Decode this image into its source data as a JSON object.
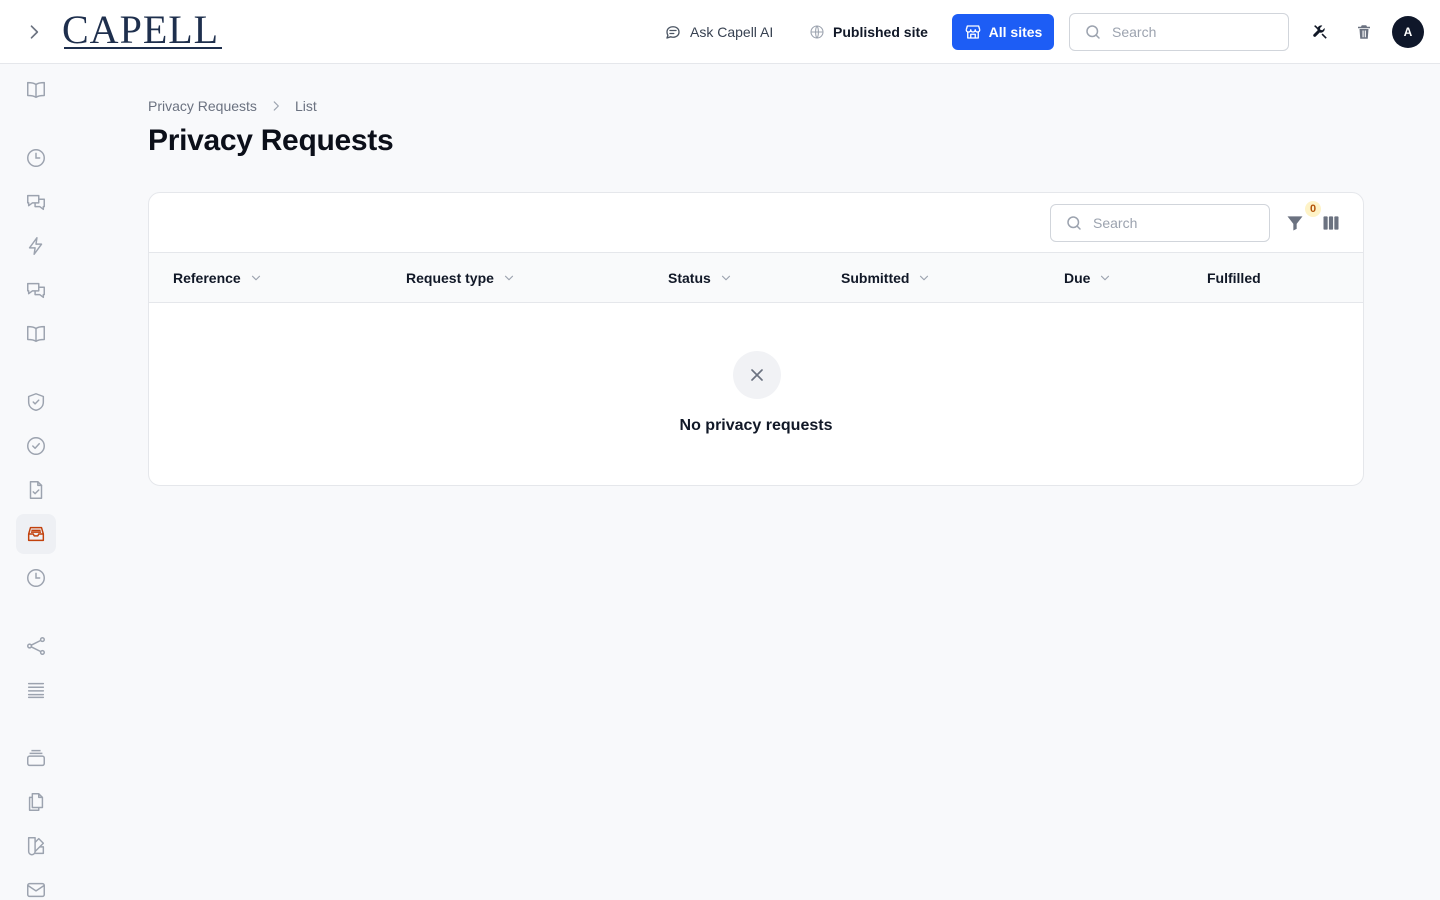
{
  "header": {
    "logo_text": "CAPELL",
    "ask_ai_label": "Ask Capell AI",
    "published_site_label": "Published site",
    "all_sites_label": "All sites",
    "search_placeholder": "Search",
    "avatar_initial": "A"
  },
  "sidebar": {
    "items": [
      {
        "name": "book-open-icon"
      },
      {
        "name": "clock-icon"
      },
      {
        "name": "chat-bubbles-icon"
      },
      {
        "name": "lightning-icon"
      },
      {
        "name": "chat-bubbles-icon"
      },
      {
        "name": "book-open-icon"
      },
      {
        "name": "shield-check-icon"
      },
      {
        "name": "check-circle-icon"
      },
      {
        "name": "document-check-icon"
      },
      {
        "name": "inbox-stack-icon",
        "active": true
      },
      {
        "name": "clock-icon"
      },
      {
        "name": "share-icon"
      },
      {
        "name": "queue-list-icon"
      },
      {
        "name": "rectangle-stack-icon"
      },
      {
        "name": "document-duplicate-icon"
      },
      {
        "name": "swatch-icon"
      },
      {
        "name": "envelope-icon"
      }
    ]
  },
  "breadcrumb": {
    "items": [
      "Privacy Requests",
      "List"
    ]
  },
  "page": {
    "title": "Privacy Requests"
  },
  "table": {
    "search_placeholder": "Search",
    "filter_count": "0",
    "columns": [
      {
        "label": "Reference",
        "sortable": true
      },
      {
        "label": "Request type",
        "sortable": true
      },
      {
        "label": "Status",
        "sortable": true
      },
      {
        "label": "Submitted",
        "sortable": true
      },
      {
        "label": "Due",
        "sortable": true
      },
      {
        "label": "Fulfilled",
        "sortable": false
      }
    ],
    "empty_message": "No privacy requests"
  },
  "colors": {
    "accent": "#1d5df5",
    "active_icon": "#c2410c",
    "icon_gray": "#9ca3af"
  }
}
